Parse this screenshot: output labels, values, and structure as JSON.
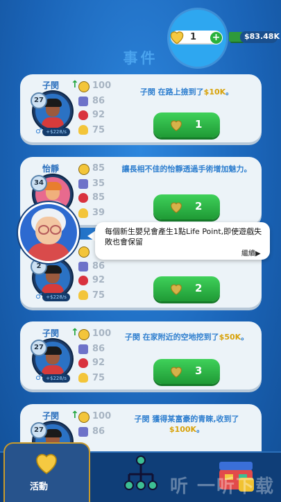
{
  "header": {
    "life_points": "1",
    "money": "$83.48K",
    "title": "事件"
  },
  "cards": [
    {
      "name": "子閔",
      "age": "27",
      "income": "+$228/s",
      "happy": "100",
      "smart": "86",
      "health": "92",
      "looks": "75",
      "event_pre": "子閔 在路上撿到了",
      "event_amount": "$10K",
      "event_post": "。",
      "cost": "1"
    },
    {
      "name": "怡靜",
      "age": "34",
      "happy": "85",
      "smart": "35",
      "health": "85",
      "looks": "39",
      "event_pre": "讓長相不佳的怡靜透過手術增加魅力。",
      "event_amount": "",
      "event_post": "",
      "cost": "2"
    },
    {
      "name": "",
      "age": "2",
      "income": "+$228/s",
      "happy": "",
      "smart": "86",
      "health": "92",
      "looks": "75",
      "cost": "2"
    },
    {
      "name": "子閔",
      "age": "27",
      "income": "+$228/s",
      "happy": "100",
      "smart": "86",
      "health": "92",
      "looks": "75",
      "event_pre": "子閔 在家附近的空地挖到了",
      "event_amount": "$50K",
      "event_post": "。",
      "cost": "3"
    },
    {
      "name": "子閔",
      "age": "27",
      "happy": "100",
      "smart": "86",
      "event_pre": "子閔 獲得某富豪的青睞,收到了",
      "event_amount": "$100K",
      "event_post": "。"
    }
  ],
  "tooltip": {
    "text": "每個新生嬰兒會產生1點Life Point,即使遊戲失敗也會保留",
    "next": "繼續"
  },
  "nav": {
    "active_label": "活動"
  },
  "watermark": "听 一听下载",
  "colors": {
    "primary_blue": "#1c6fc4",
    "button_green": "#2fb548",
    "gold": "#d8a20a"
  }
}
